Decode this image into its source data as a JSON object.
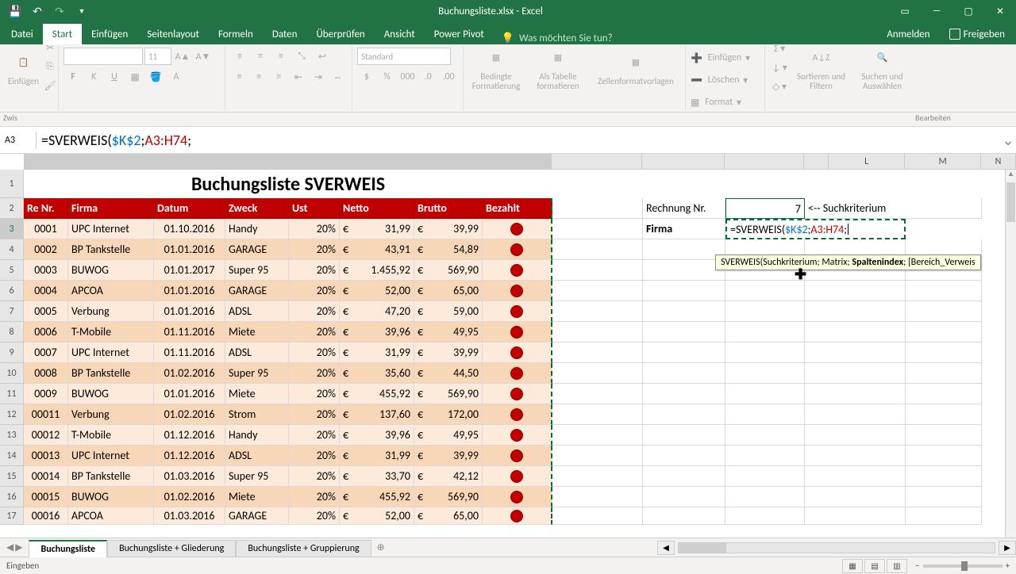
{
  "title": "Buchungsliste.xlsx - Excel",
  "qat": {
    "save": "💾"
  },
  "tabs": [
    "Datei",
    "Start",
    "Einfügen",
    "Seitenlayout",
    "Formeln",
    "Daten",
    "Überprüfen",
    "Ansicht",
    "Power Pivot"
  ],
  "tell_me": "Was möchten Sie tun?",
  "login": "Anmelden",
  "share": "Freigeben",
  "ribbon": {
    "paste": "Einfügen",
    "font_size": "11",
    "number_format": "Standard",
    "conditional": "Bedingte\nFormatierung",
    "as_table": "Als Tabelle\nformatieren",
    "cell_styles": "Zellenformatvorlagen",
    "insert": "Einfügen",
    "delete": "Löschen",
    "format": "Format",
    "sort_filter": "Sortieren und\nFiltern",
    "find_select": "Suchen und\nAuswählen",
    "group_clip": "Zwis",
    "group_edit": "Bearbeiten"
  },
  "name_box": "A3",
  "formula": {
    "prefix": "=SVERWEIS(",
    "ref1": "$K$2",
    "sep1": ";",
    "ref2": "A3:H74",
    "suffix": ";"
  },
  "col_letters_right": [
    "L",
    "M",
    "N"
  ],
  "row_headers": [
    "1",
    "2",
    "3",
    "4",
    "5",
    "6",
    "7",
    "8",
    "9",
    "10",
    "11",
    "12",
    "13",
    "14",
    "15",
    "16",
    "17"
  ],
  "sheet_title": "Buchungsliste SVERWEIS",
  "headers": [
    "Re Nr.",
    "Firma",
    "Datum",
    "Zweck",
    "Ust",
    "Netto",
    "Brutto",
    "Bezahlt"
  ],
  "rows": [
    {
      "nr": "0001",
      "firma": "UPC Internet",
      "datum": "01.10.2016",
      "zweck": "Handy",
      "ust": "20%",
      "netto": "31,99",
      "brutto": "39,99"
    },
    {
      "nr": "0002",
      "firma": "BP Tankstelle",
      "datum": "01.01.2016",
      "zweck": "GARAGE",
      "ust": "20%",
      "netto": "43,91",
      "brutto": "54,89"
    },
    {
      "nr": "0003",
      "firma": "BUWOG",
      "datum": "01.01.2017",
      "zweck": "Super 95",
      "ust": "20%",
      "netto": "1.455,92",
      "brutto": "569,90"
    },
    {
      "nr": "0004",
      "firma": "APCOA",
      "datum": "01.01.2016",
      "zweck": "GARAGE",
      "ust": "20%",
      "netto": "52,00",
      "brutto": "65,00"
    },
    {
      "nr": "0005",
      "firma": "Verbung",
      "datum": "01.01.2016",
      "zweck": "ADSL",
      "ust": "20%",
      "netto": "47,20",
      "brutto": "59,00"
    },
    {
      "nr": "0006",
      "firma": "T-Mobile",
      "datum": "01.11.2016",
      "zweck": "Miete",
      "ust": "20%",
      "netto": "39,96",
      "brutto": "49,95"
    },
    {
      "nr": "0007",
      "firma": "UPC Internet",
      "datum": "01.11.2016",
      "zweck": "ADSL",
      "ust": "20%",
      "netto": "31,99",
      "brutto": "39,99"
    },
    {
      "nr": "0008",
      "firma": "BP Tankstelle",
      "datum": "01.02.2016",
      "zweck": "Super 95",
      "ust": "20%",
      "netto": "35,60",
      "brutto": "44,50"
    },
    {
      "nr": "0009",
      "firma": "BUWOG",
      "datum": "01.01.2016",
      "zweck": "Miete",
      "ust": "20%",
      "netto": "455,92",
      "brutto": "569,90"
    },
    {
      "nr": "00011",
      "firma": "Verbung",
      "datum": "01.02.2016",
      "zweck": "Strom",
      "ust": "20%",
      "netto": "137,60",
      "brutto": "172,00"
    },
    {
      "nr": "00012",
      "firma": "T-Mobile",
      "datum": "01.12.2016",
      "zweck": "Handy",
      "ust": "20%",
      "netto": "39,96",
      "brutto": "49,95"
    },
    {
      "nr": "00013",
      "firma": "UPC Internet",
      "datum": "01.12.2016",
      "zweck": "ADSL",
      "ust": "20%",
      "netto": "31,99",
      "brutto": "39,99"
    },
    {
      "nr": "00014",
      "firma": "BP Tankstelle",
      "datum": "01.03.2016",
      "zweck": "Super 95",
      "ust": "20%",
      "netto": "33,70",
      "brutto": "42,12"
    },
    {
      "nr": "00015",
      "firma": "BUWOG",
      "datum": "01.02.2016",
      "zweck": "Miete",
      "ust": "20%",
      "netto": "455,92",
      "brutto": "569,90"
    },
    {
      "nr": "00016",
      "firma": "APCOA",
      "datum": "01.03.2016",
      "zweck": "GARAGE",
      "ust": "20%",
      "netto": "52,00",
      "brutto": "65,00"
    }
  ],
  "curr": "€",
  "lookup": {
    "rechnung_label": "Rechnung Nr.",
    "rechnung_value": "7",
    "suchkriterium": "<-- Suchkriterium",
    "firma_label": "Firma",
    "hint_prefix": "SVERWEIS(Suchkriterium; Matrix; ",
    "hint_bold": "Spaltenindex",
    "hint_suffix": "; [Bereich_Verweis"
  },
  "sheet_tabs": [
    "Buchungsliste",
    "Buchungsliste + Gliederung",
    "Buchungsliste + Gruppierung"
  ],
  "status": "Eingeben",
  "zoom": "100%"
}
